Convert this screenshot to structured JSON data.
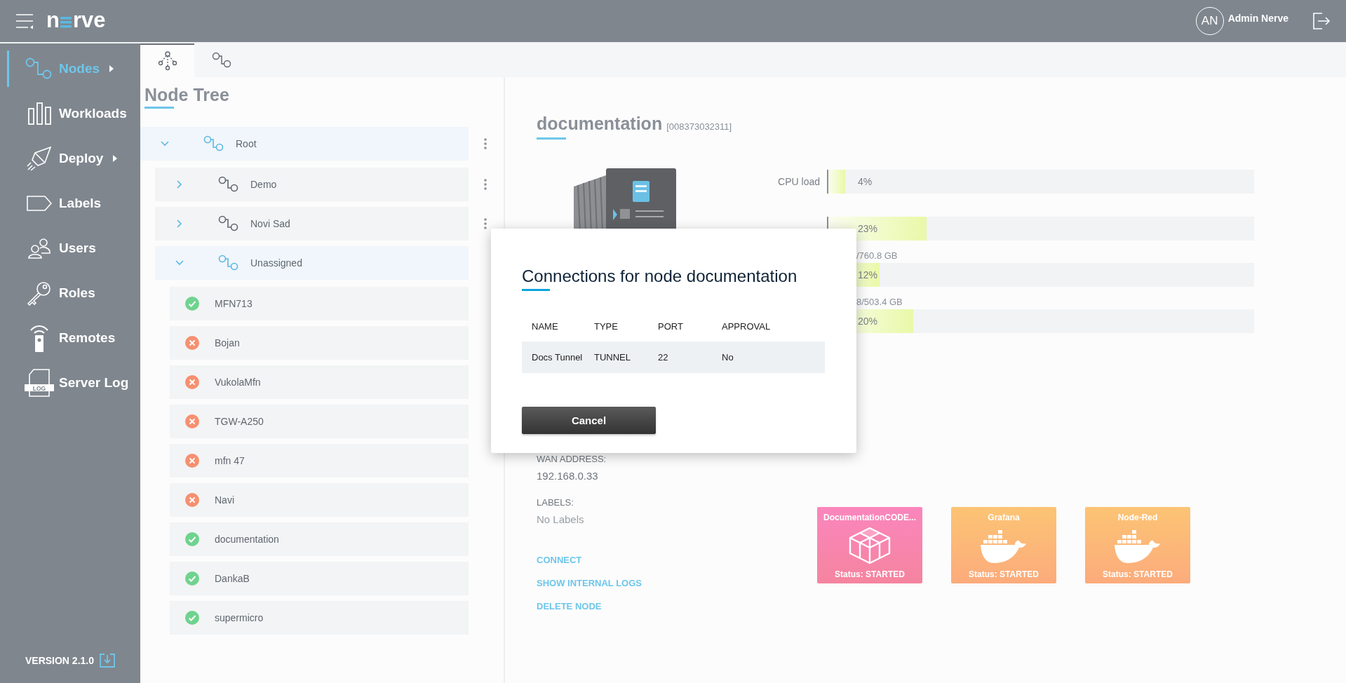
{
  "header": {
    "logo_text": [
      "n",
      "rve"
    ],
    "user_initials": "AN",
    "user_name": "Admin Nerve"
  },
  "sidebar": {
    "items": [
      {
        "label": "Nodes",
        "selected": true,
        "submenu": true
      },
      {
        "label": "Workloads",
        "selected": false,
        "submenu": false
      },
      {
        "label": "Deploy",
        "selected": false,
        "submenu": true
      },
      {
        "label": "Labels",
        "selected": false,
        "submenu": false
      },
      {
        "label": "Users",
        "selected": false,
        "submenu": false
      },
      {
        "label": "Roles",
        "selected": false,
        "submenu": false
      },
      {
        "label": "Remotes",
        "selected": false,
        "submenu": false
      },
      {
        "label": "Server Log",
        "selected": false,
        "submenu": false,
        "icon_text": "LOG"
      }
    ],
    "version": "VERSION 2.1.0"
  },
  "tabs": [
    {
      "selected": true
    },
    {
      "selected": false
    }
  ],
  "node_tree": {
    "title": "Node Tree",
    "nodes": [
      {
        "kind": "group",
        "name": "Root",
        "expanded": true,
        "menu": true,
        "children": [
          {
            "kind": "group",
            "name": "Demo",
            "expanded": false,
            "menu": true
          },
          {
            "kind": "group",
            "name": "Novi Sad",
            "expanded": false,
            "menu": true
          },
          {
            "kind": "group",
            "name": "Unassigned",
            "expanded": true,
            "menu": false,
            "children": [
              {
                "kind": "device",
                "name": "MFN713",
                "online": true
              },
              {
                "kind": "device",
                "name": "Bojan",
                "online": false
              },
              {
                "kind": "device",
                "name": "VukolaMfn",
                "online": false
              },
              {
                "kind": "device",
                "name": "TGW-A250",
                "online": false
              },
              {
                "kind": "device",
                "name": "mfn 47",
                "online": false
              },
              {
                "kind": "device",
                "name": "Navi",
                "online": false
              },
              {
                "kind": "device",
                "name": "documentation",
                "online": true
              },
              {
                "kind": "device",
                "name": "DankaB",
                "online": true
              },
              {
                "kind": "device",
                "name": "supermicro",
                "online": true
              }
            ]
          }
        ]
      }
    ]
  },
  "node_detail": {
    "name": "documentation",
    "serial": "[008373032311]",
    "device_image": {
      "kind": "picture"
    },
    "metrics": [
      {
        "kind": "side",
        "label": "CPU load",
        "level": 0.04,
        "reading": "4%"
      },
      {
        "kind": "side",
        "level": 0.23,
        "reading": "23%"
      },
      {
        "kind": "above",
        "label": "/760.8 GB",
        "level": 0.12,
        "reading": "12%"
      },
      {
        "kind": "above",
        "label": "8/503.4 GB",
        "level": 0.2,
        "reading": "20%"
      }
    ],
    "fields": [
      {
        "label": "WAN ADDRESS:",
        "value": "192.168.0.33",
        "muted": false
      },
      {
        "label": "LABELS:",
        "value": "No Labels",
        "muted": true
      }
    ],
    "actions": [
      "CONNECT",
      "SHOW INTERNAL LOGS",
      "DELETE NODE"
    ],
    "workloads": [
      {
        "kind": "vm",
        "name": "DocumentationCODE...",
        "status": "Status: STARTED"
      },
      {
        "kind": "docker",
        "name": "Grafana",
        "status": "Status: STARTED"
      },
      {
        "kind": "docker",
        "name": "Node-Red",
        "status": "Status: STARTED"
      }
    ]
  },
  "dialog": {
    "title": "Connections for node documentation",
    "columns": [
      "NAME",
      "TYPE",
      "PORT",
      "APPROVAL"
    ],
    "rows": [
      [
        "Docs Tunnel",
        "TUNNEL",
        "22",
        "No"
      ]
    ],
    "cancel": "Cancel"
  }
}
